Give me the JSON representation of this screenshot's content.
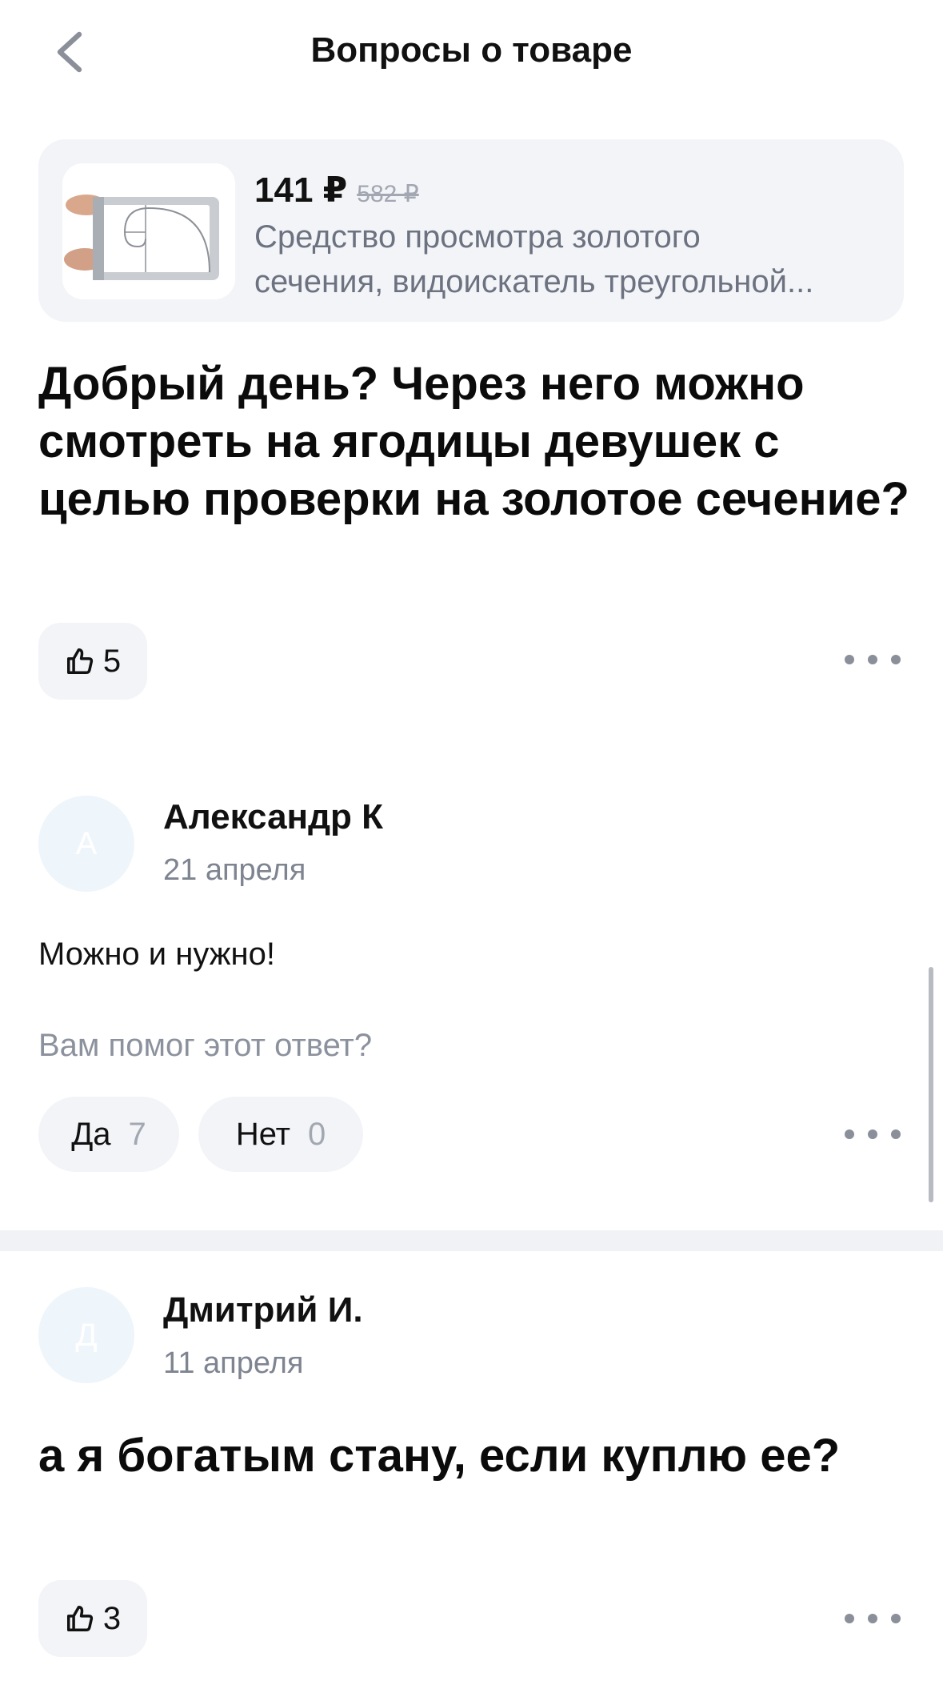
{
  "header": {
    "title": "Вопросы о товаре"
  },
  "product": {
    "price": "141 ₽",
    "old_price": "582 ₽",
    "name_line1": "Средство просмотра золотого",
    "name_line2": "сечения, видоискатель треугольной..."
  },
  "question": {
    "text": "Добрый день? Через него можно смотреть на ягодицы девушек с целью проверки на золотое сечение?",
    "likes": "5"
  },
  "answers": [
    {
      "avatar_letter": "А",
      "author": "Александр К",
      "date": "21 апреля",
      "text": "Можно и нужно!",
      "helpful_prompt": "Вам помог этот ответ?",
      "yes_label": "Да",
      "yes_count": "7",
      "no_label": "Нет",
      "no_count": "0"
    },
    {
      "avatar_letter": "Д",
      "author": "Дмитрий И.",
      "date": "11 апреля",
      "text": "а я богатым стану, если куплю ее?",
      "likes": "3"
    }
  ],
  "icons": {
    "back": "chevron-left-icon",
    "like": "thumbs-up-icon",
    "more": "more-horizontal-icon"
  },
  "colors": {
    "card_bg": "#f3f4f8",
    "muted_text": "#6c7280",
    "avatar_bg": "#eef5fb"
  }
}
